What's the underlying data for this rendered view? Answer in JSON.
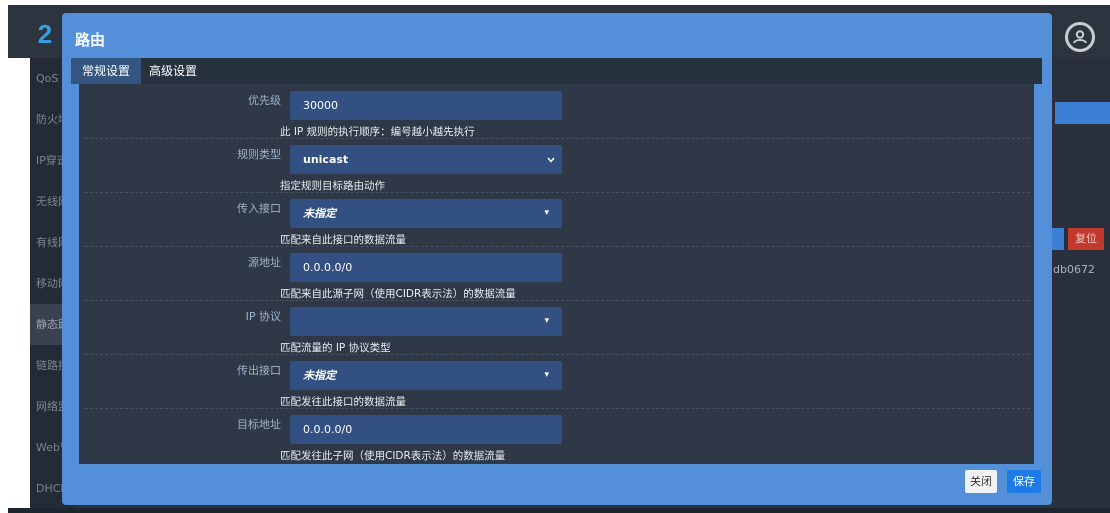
{
  "app": {
    "logo_text": "2",
    "sidebar": [
      {
        "label": "QoS"
      },
      {
        "label": "防火墙"
      },
      {
        "label": "IP穿透"
      },
      {
        "label": "无线网络"
      },
      {
        "label": "有线网络"
      },
      {
        "label": "移动网络"
      },
      {
        "label": "静态路由",
        "active": true
      },
      {
        "label": "链路控制"
      },
      {
        "label": "网络监控"
      },
      {
        "label": "Web管理"
      },
      {
        "label": "DHCP/DI"
      }
    ],
    "bg_reset_label": "复位",
    "bg_id_text": "db0672"
  },
  "modal": {
    "title": "路由",
    "tabs": [
      {
        "label": "常规设置",
        "active": true
      },
      {
        "label": "高级设置",
        "active": false
      }
    ],
    "fields": [
      {
        "label": "优先级",
        "value": "30000",
        "kind": "text",
        "hint": "此 IP 规则的执行顺序：编号越小越先执行"
      },
      {
        "label": "规则类型",
        "value": "unicast",
        "kind": "select",
        "hint": "指定规则目标路由动作"
      },
      {
        "label": "传入接口",
        "value": "未指定",
        "kind": "dropdown",
        "hint": "匹配来自此接口的数据流量"
      },
      {
        "label": "源地址",
        "value": "0.0.0.0/0",
        "kind": "text",
        "hint": "匹配来自此源子网（使用CIDR表示法）的数据流量"
      },
      {
        "label": "IP 协议",
        "value": "",
        "kind": "dropdown",
        "hint": "匹配流量的 IP 协议类型"
      },
      {
        "label": "传出接口",
        "value": "未指定",
        "kind": "dropdown",
        "hint": "匹配发往此接口的数据流量"
      },
      {
        "label": "目标地址",
        "value": "0.0.0.0/0",
        "kind": "text",
        "hint": "匹配发往此子网（使用CIDR表示法）的数据流量"
      }
    ],
    "close_label": "关闭",
    "save_label": "保存"
  },
  "colors": {
    "modal_bg": "#5390d9",
    "panel_bg": "#2f3846",
    "field_bg": "#335082",
    "save_button": "#1e7be6",
    "danger_button": "#c0392b"
  },
  "icons": {
    "avatar": "user-circle-icon",
    "select_arrow": "chevron-down-icon",
    "dropdown_caret": "caret-down-icon"
  }
}
